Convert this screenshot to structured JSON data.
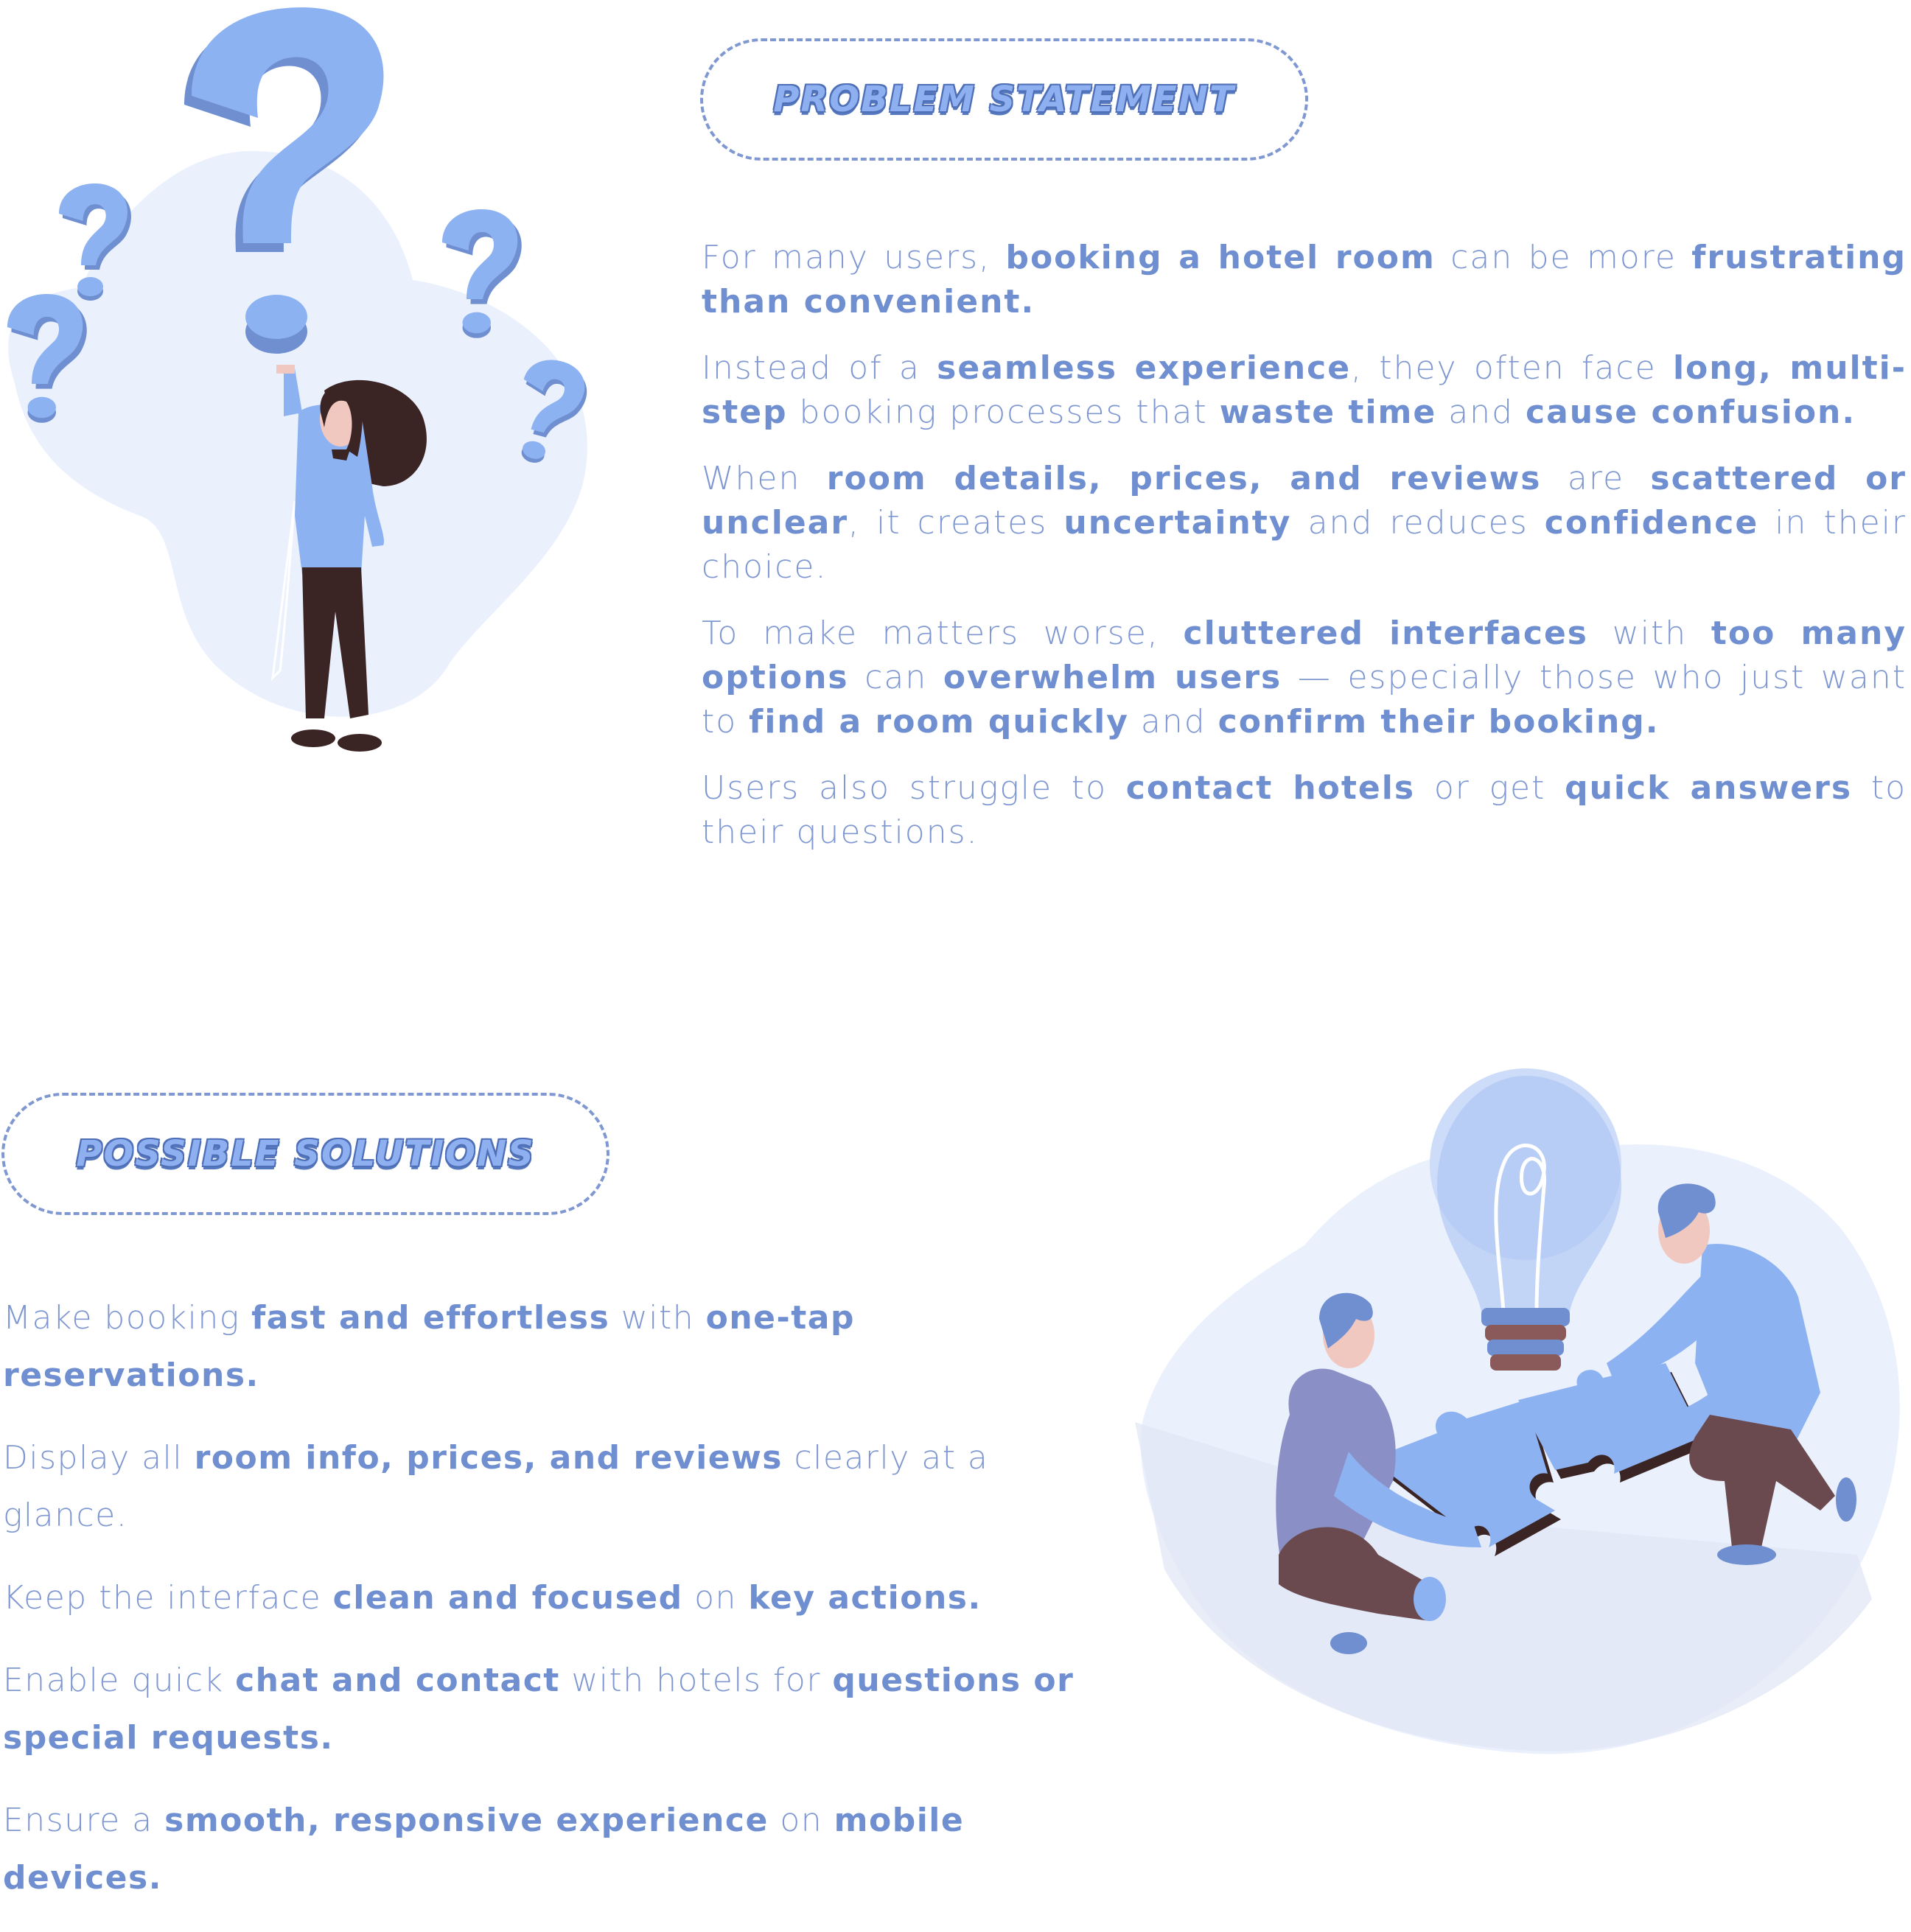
{
  "problem": {
    "title": "PROBLEM STATEMENT",
    "paragraphs": [
      [
        {
          "t": "For many users, ",
          "b": false
        },
        {
          "t": "booking a hotel room",
          "b": true
        },
        {
          "t": " can be more ",
          "b": false
        },
        {
          "t": "frustrating than convenient.",
          "b": true
        }
      ],
      [
        {
          "t": "Instead of a ",
          "b": false
        },
        {
          "t": "seamless experience",
          "b": true
        },
        {
          "t": ", they often face ",
          "b": false
        },
        {
          "t": "long, multi-step",
          "b": true
        },
        {
          "t": " booking processes that ",
          "b": false
        },
        {
          "t": "waste time",
          "b": true
        },
        {
          "t": " and ",
          "b": false
        },
        {
          "t": "cause confusion.",
          "b": true
        }
      ],
      [
        {
          "t": "When ",
          "b": false
        },
        {
          "t": "room details, prices, and reviews",
          "b": true
        },
        {
          "t": " are ",
          "b": false
        },
        {
          "t": "scattered or unclear",
          "b": true
        },
        {
          "t": ", it creates ",
          "b": false
        },
        {
          "t": "uncertainty",
          "b": true
        },
        {
          "t": " and reduces ",
          "b": false
        },
        {
          "t": "confidence",
          "b": true
        },
        {
          "t": " in their choice.",
          "b": false
        }
      ],
      [
        {
          "t": "To make matters worse, ",
          "b": false
        },
        {
          "t": "cluttered interfaces",
          "b": true
        },
        {
          "t": " with ",
          "b": false
        },
        {
          "t": "too many options",
          "b": true
        },
        {
          "t": " can ",
          "b": false
        },
        {
          "t": "overwhelm users",
          "b": true
        },
        {
          "t": " — especially those who just want to ",
          "b": false
        },
        {
          "t": "find a room quickly",
          "b": true
        },
        {
          "t": " and ",
          "b": false
        },
        {
          "t": "confirm their booking.",
          "b": true
        }
      ],
      [
        {
          "t": "Users also struggle to ",
          "b": false
        },
        {
          "t": "contact hotels",
          "b": true
        },
        {
          "t": " or get ",
          "b": false
        },
        {
          "t": "quick answers",
          "b": true
        },
        {
          "t": " to their questions.",
          "b": false
        }
      ]
    ]
  },
  "solutions": {
    "title": "POSSIBLE SOLUTIONS",
    "paragraphs": [
      [
        {
          "t": "Make booking ",
          "b": false
        },
        {
          "t": "fast and effortless",
          "b": true
        },
        {
          "t": " with ",
          "b": false
        },
        {
          "t": "one-tap reservations.",
          "b": true
        }
      ],
      [
        {
          "t": "Display all ",
          "b": false
        },
        {
          "t": "room info, prices, and reviews",
          "b": true
        },
        {
          "t": " clearly at a glance.",
          "b": false
        }
      ],
      [
        {
          "t": "Keep the interface ",
          "b": false
        },
        {
          "t": "clean and focused",
          "b": true
        },
        {
          "t": " on ",
          "b": false
        },
        {
          "t": "key actions.",
          "b": true
        }
      ],
      [
        {
          "t": "Enable quick ",
          "b": false
        },
        {
          "t": "chat and contact",
          "b": true
        },
        {
          "t": " with hotels for ",
          "b": false
        },
        {
          "t": "questions or special requests.",
          "b": true
        }
      ],
      [
        {
          "t": "Ensure a ",
          "b": false
        },
        {
          "t": "smooth, responsive experience",
          "b": true
        },
        {
          "t": " on ",
          "b": false
        },
        {
          "t": "mobile devices.",
          "b": true
        }
      ]
    ]
  },
  "illustrations": {
    "top_left": "woman-with-question-marks-illustration",
    "bottom_right": "people-joining-puzzle-with-lightbulb-illustration"
  },
  "colors": {
    "accent": "#7f98d2",
    "light_blob": "#eaf1fd",
    "question_mark": "#8db2f2",
    "question_mark_dark": "#6f8fd0",
    "dark_brown": "#3a2424"
  }
}
